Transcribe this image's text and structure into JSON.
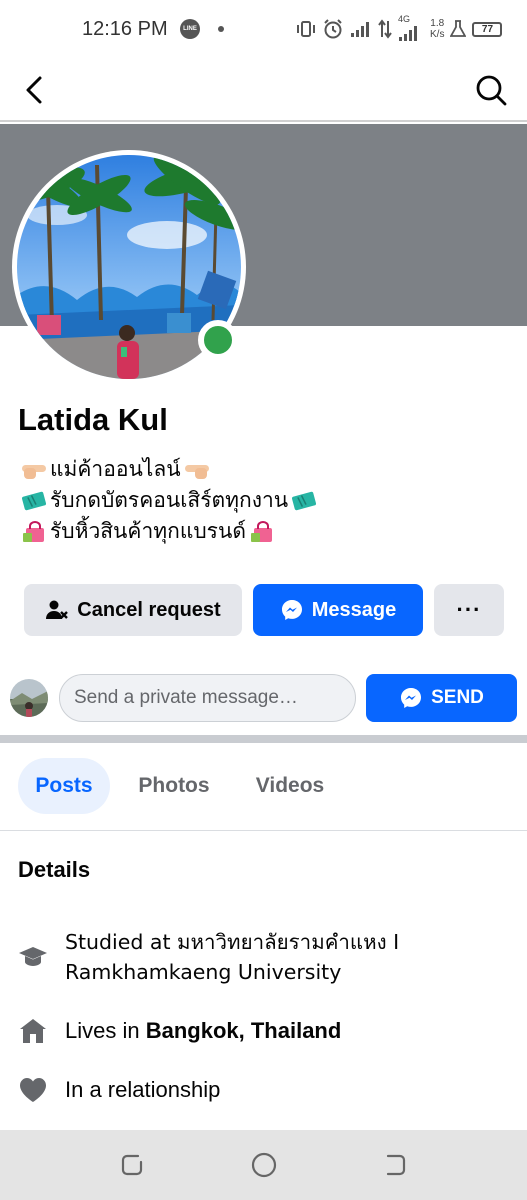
{
  "status_bar": {
    "time": "12:16 PM",
    "line_icon": "LINE",
    "network": "4G",
    "speed_value": "1.8",
    "speed_unit": "K/s",
    "battery": "77"
  },
  "nav": {
    "back_icon": "chevron-left-icon",
    "search_icon": "search-icon"
  },
  "profile": {
    "name": "Latida Kul",
    "online": true,
    "bio": [
      {
        "pre": "point-right-emoji",
        "text": "แม่ค้าออนไลน์",
        "post": "point-left-emoji"
      },
      {
        "pre": "ticket-emoji",
        "text": "รับกดบัตรคอนเสิร์ตทุกงาน",
        "post": "ticket-emoji"
      },
      {
        "pre": "shopping-bag-emoji",
        "text": "รับหิ้วสินค้าทุกแบรนด์",
        "post": "shopping-bag-emoji"
      }
    ]
  },
  "actions": {
    "cancel_request": "Cancel request",
    "message": "Message",
    "more": "···"
  },
  "private_message": {
    "placeholder": "Send a private message…",
    "send": "SEND"
  },
  "tabs": [
    {
      "label": "Posts",
      "active": true
    },
    {
      "label": "Photos",
      "active": false
    },
    {
      "label": "Videos",
      "active": false
    }
  ],
  "details": {
    "title": "Details",
    "education": "Studied at มหาวิทยาลัยรามคำแหง I Ramkhamkaeng University",
    "lives_prefix": "Lives in ",
    "lives_place": "Bangkok, Thailand",
    "relationship": "In a relationship"
  },
  "colors": {
    "brand_blue": "#0866ff",
    "button_gray": "#e4e6eb",
    "online_green": "#31a24c",
    "cover_gray": "#7d8186"
  }
}
